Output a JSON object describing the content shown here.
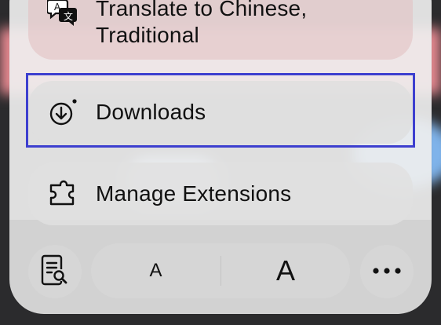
{
  "menu": {
    "translate_label": "Translate to Chinese,\nTraditional",
    "downloads_label": "Downloads",
    "manage_extensions_label": "Manage Extensions"
  },
  "toolbar": {
    "font_smaller_label": "A",
    "font_larger_label": "A"
  },
  "icons": {
    "translate": "translate-icon",
    "downloads": "download-circle-icon",
    "manage_extensions": "puzzle-icon",
    "reader": "reader-search-icon",
    "more": "ellipsis-icon"
  },
  "colors": {
    "highlight_border": "#3d3fcf"
  }
}
